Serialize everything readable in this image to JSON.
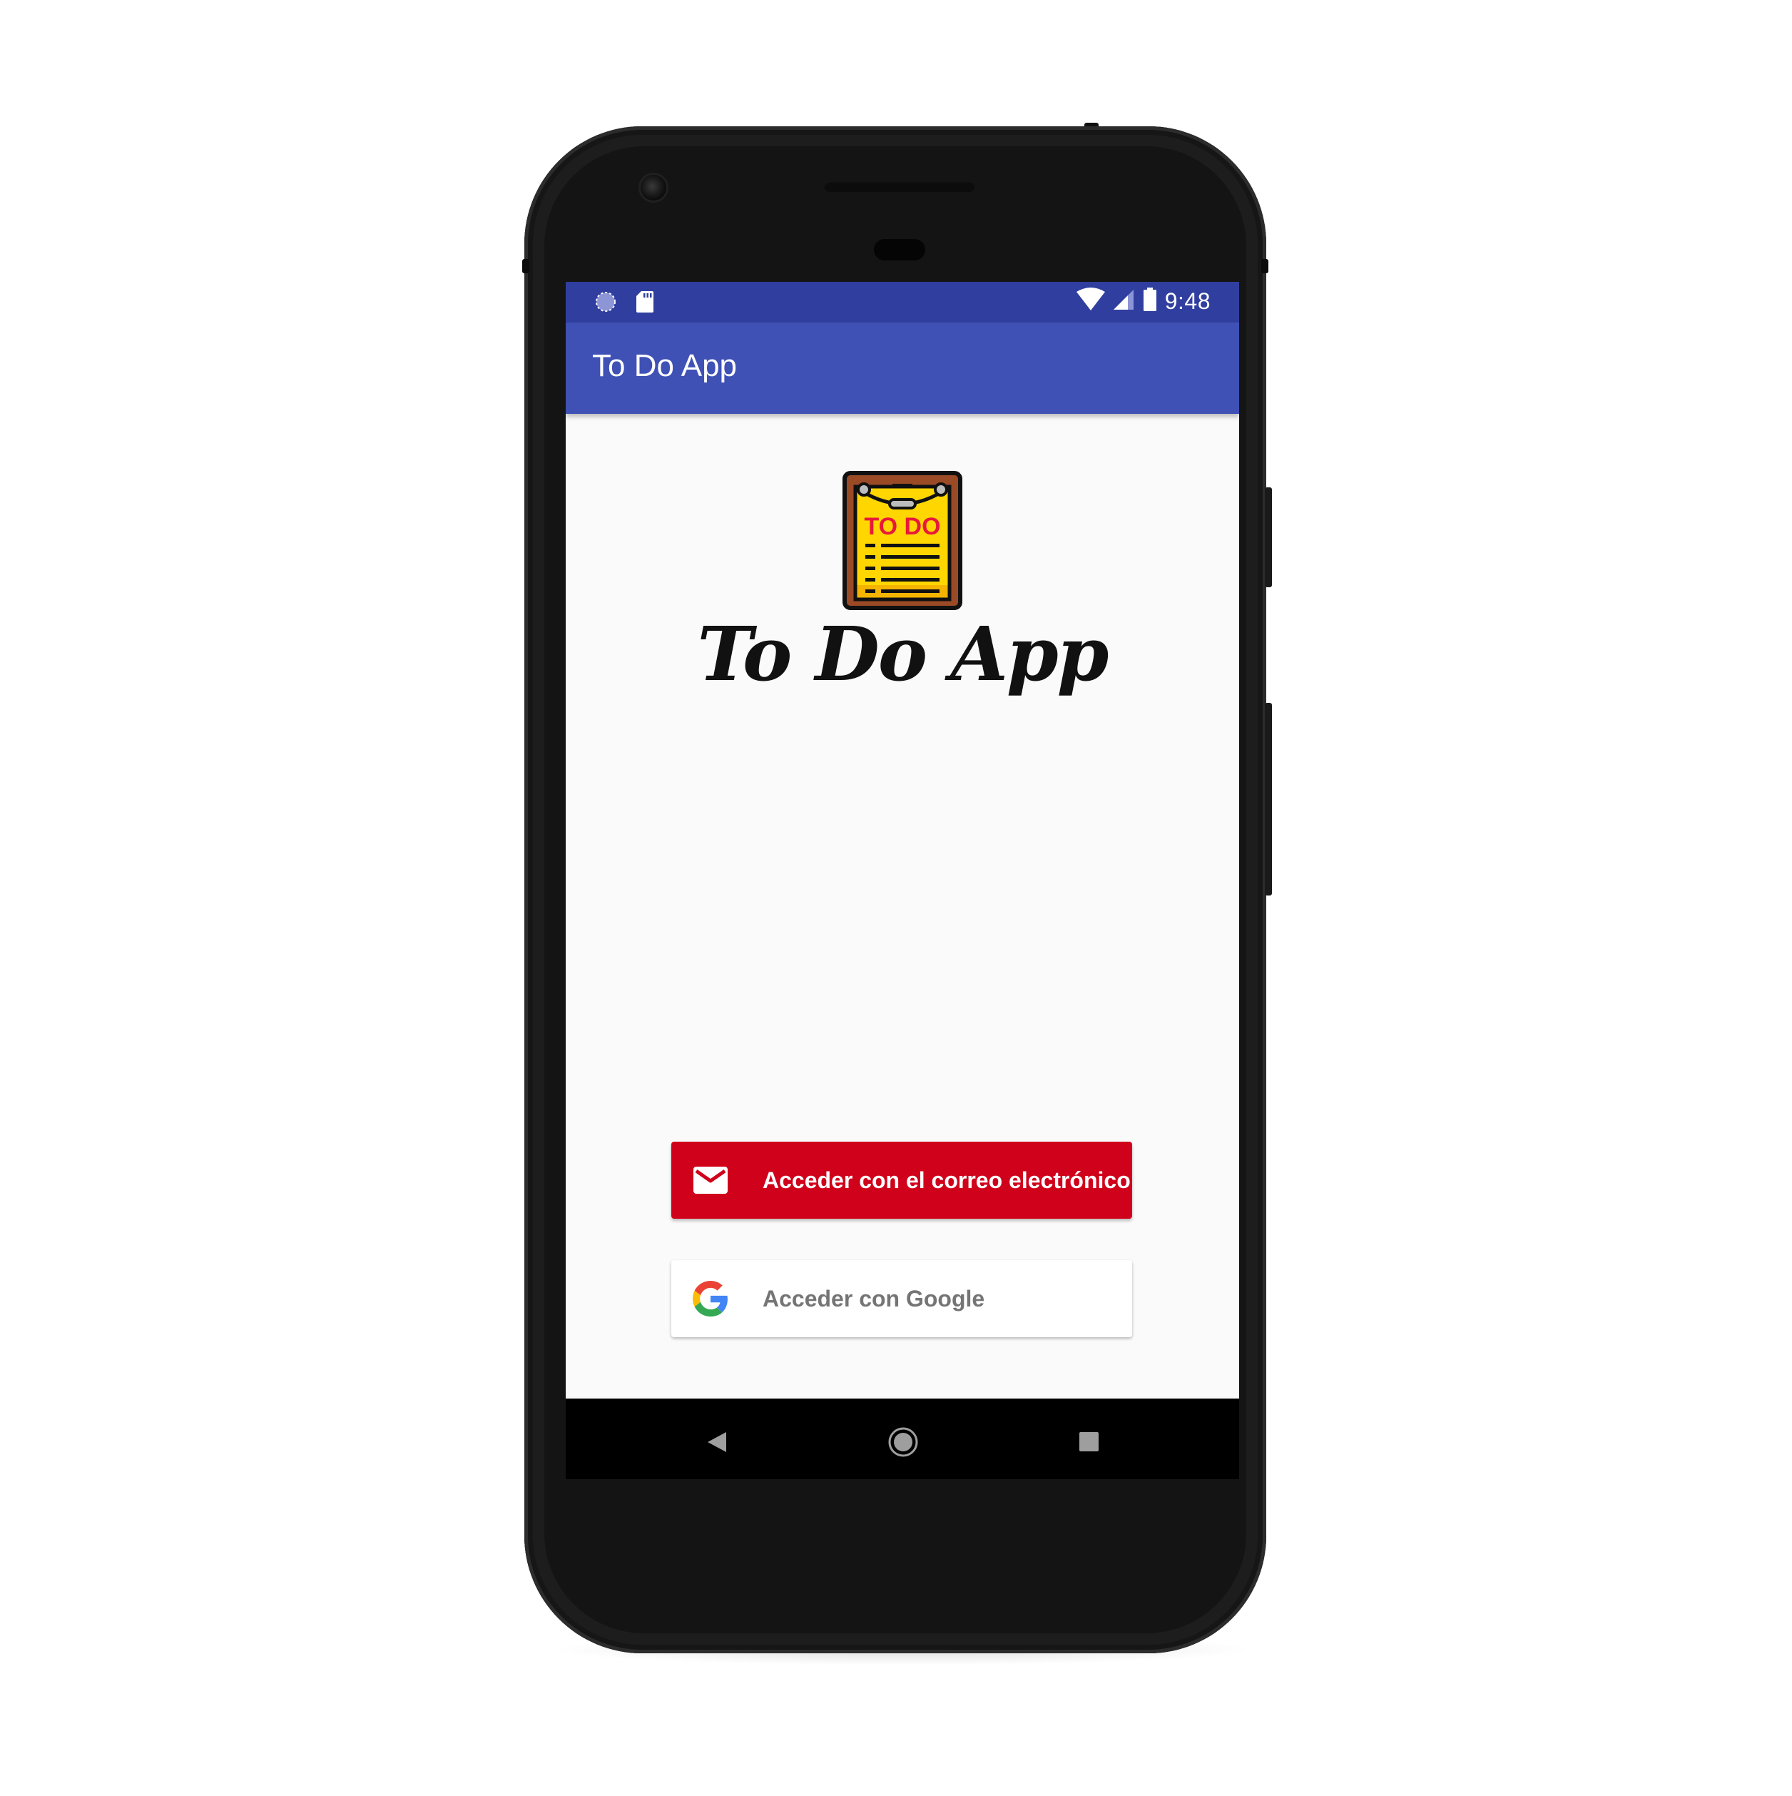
{
  "status_bar": {
    "time": "9:48",
    "left_icons": [
      "sync-icon",
      "sd-card-icon"
    ],
    "right_icons": [
      "wifi-icon",
      "cell-signal-icon",
      "battery-icon"
    ],
    "color": "#303F9F"
  },
  "app_bar": {
    "title": "To Do App",
    "color": "#3F51B5"
  },
  "logo": {
    "icon_text": "TO DO",
    "title": "To Do App"
  },
  "buttons": {
    "email": {
      "label": "Acceder con el correo electrónico",
      "icon": "mail-icon",
      "color": "#d0021b"
    },
    "google": {
      "label": "Acceder con Google",
      "icon": "google-icon",
      "color": "#ffffff"
    }
  },
  "navigation": {
    "items": [
      "back",
      "home",
      "recents"
    ]
  }
}
